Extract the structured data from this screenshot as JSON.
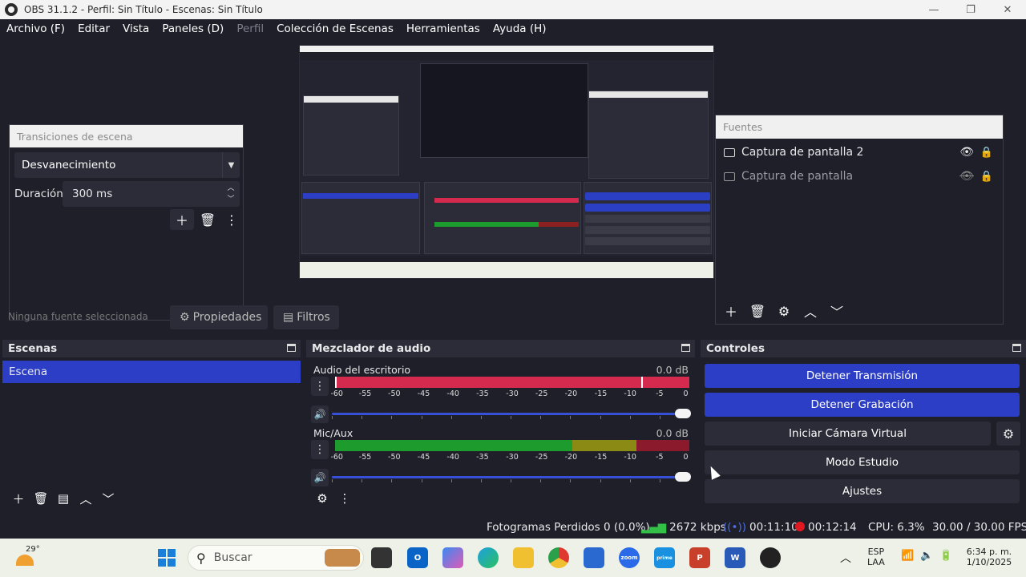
{
  "window": {
    "title": "OBS 31.1.2 - Perfil: Sin Título - Escenas: Sin Título",
    "minimize": "—",
    "maximize": "❐",
    "close": "✕"
  },
  "menu": {
    "items": [
      "Archivo (F)",
      "Editar",
      "Vista",
      "Paneles (D)",
      "Perfil",
      "Colección de Escenas",
      "Herramientas",
      "Ayuda (H)"
    ],
    "disabled_index": 4
  },
  "transitions": {
    "title": "Transiciones de escena",
    "selected": "Desvanecimiento",
    "duration_label": "Duración",
    "duration_value": "300 ms"
  },
  "sources": {
    "title": "Fuentes",
    "items": [
      {
        "label": "Captura de pantalla 2",
        "visible": true
      },
      {
        "label": "Captura de pantalla",
        "visible": false
      }
    ]
  },
  "under_bar": {
    "hidden_text": "Ninguna fuente seleccionada",
    "properties": "Propiedades",
    "filters": "Filtros"
  },
  "scenes": {
    "title": "Escenas",
    "items": [
      "Escena"
    ]
  },
  "mixer": {
    "title": "Mezclador de audio",
    "ticks": [
      "-60",
      "-55",
      "-50",
      "-45",
      "-40",
      "-35",
      "-30",
      "-25",
      "-20",
      "-15",
      "-10",
      "-5",
      "0"
    ],
    "channels": [
      {
        "name": "Audio del escritorio",
        "db": "0.0 dB",
        "level": 1.0
      },
      {
        "name": "Mic/Aux",
        "db": "0.0 dB",
        "level": 1.0
      }
    ]
  },
  "controls": {
    "title": "Controles",
    "stop_stream": "Detener Transmisión",
    "stop_record": "Detener Grabación",
    "virtual_cam": "Iniciar Cámara Virtual",
    "studio_mode": "Modo Estudio",
    "settings": "Ajustes"
  },
  "status": {
    "dropped": "Fotogramas Perdidos 0 (0.0%)",
    "bitrate": "2672 kbps",
    "stream_time": "00:11:10",
    "rec_time": "00:12:14",
    "cpu": "CPU: 6.3%",
    "fps": "30.00 / 30.00 FPS"
  },
  "taskbar": {
    "temp": "29°",
    "search_placeholder": "Buscar",
    "lang_top": "ESP",
    "lang_bottom": "LAA",
    "time": "6:34 p. m.",
    "date": "1/10/2025",
    "icons": [
      "windows-icon",
      "search-icon",
      "task-view-icon",
      "outlook-icon",
      "copilot-icon",
      "edge-icon",
      "file-explorer-icon",
      "chrome-icon",
      "microsoft-store-icon",
      "zoom-icon",
      "prime-video-icon",
      "powerpoint-icon",
      "word-icon",
      "obs-icon"
    ]
  },
  "colors": {
    "accent_blue": "#2c3ec5",
    "meter_red": "#d42a4e",
    "meter_green": "#1e9b2d",
    "meter_yellow": "#8a8a14",
    "record_red": "#e01820"
  }
}
